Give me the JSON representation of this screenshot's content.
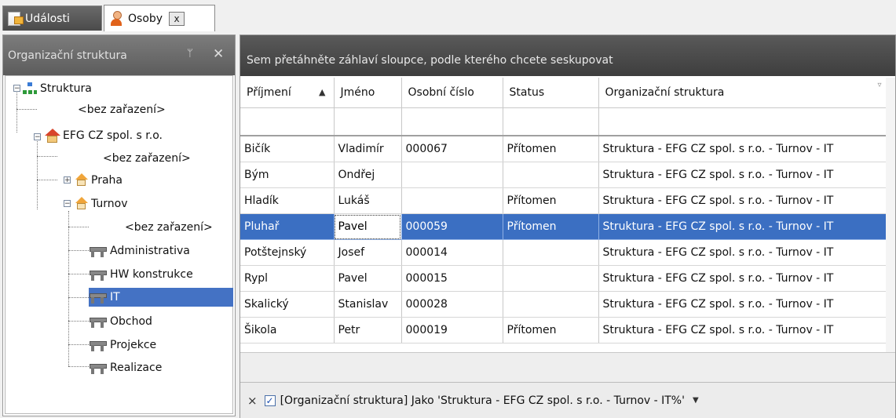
{
  "tabs": [
    {
      "label": "Události",
      "icon": "document-icon"
    },
    {
      "label": "Osoby",
      "icon": "person-icon",
      "close": "x"
    }
  ],
  "left_panel": {
    "title": "Organizační struktura",
    "pin": "ⵔ",
    "close": "✕",
    "tree": {
      "root": "Struktura",
      "root_unassigned": "<bez zařazení>",
      "company": "EFG CZ spol. s r.o.",
      "company_unassigned": "<bez zařazení>",
      "praha": "Praha",
      "turnov": "Turnov",
      "turnov_unassigned": "<bez zařazení>",
      "depts": [
        "Administrativa",
        "HW konstrukce",
        "IT",
        "Obchod",
        "Projekce",
        "Realizace"
      ],
      "selected": "IT"
    }
  },
  "grid": {
    "group_hint": "Sem přetáhněte záhlaví sloupce, podle kterého chcete seskupovat",
    "columns": [
      "Příjmení",
      "Jméno",
      "Osobní číslo",
      "Status",
      "Organizační struktura"
    ],
    "rows": [
      [
        "Bičík",
        "Vladimír",
        "000067",
        "Přítomen",
        "Struktura - EFG CZ spol. s r.o. - Turnov - IT"
      ],
      [
        "Bým",
        "Ondřej",
        "",
        "",
        "Struktura - EFG CZ spol. s r.o. - Turnov - IT"
      ],
      [
        "Hladík",
        "Lukáš",
        "",
        "Přítomen",
        "Struktura - EFG CZ spol. s r.o. - Turnov - IT"
      ],
      [
        "Pluhař",
        "Pavel",
        "000059",
        "Přítomen",
        "Struktura - EFG CZ spol. s r.o. - Turnov - IT"
      ],
      [
        "Potštejnský",
        "Josef",
        "000014",
        "",
        "Struktura - EFG CZ spol. s r.o. - Turnov - IT"
      ],
      [
        "Rypl",
        "Pavel",
        "000015",
        "",
        "Struktura - EFG CZ spol. s r.o. - Turnov - IT"
      ],
      [
        "Skalický",
        "Stanislav",
        "000028",
        "",
        "Struktura - EFG CZ spol. s r.o. - Turnov - IT"
      ],
      [
        "Šikola",
        "Petr",
        "000019",
        "Přítomen",
        "Struktura - EFG CZ spol. s r.o. - Turnov - IT"
      ]
    ],
    "selected_row": 3,
    "filter": {
      "remove": "×",
      "checked": "✓",
      "text": "[Organizační struktura] Jako 'Struktura - EFG CZ spol. s r.o. - Turnov - IT%'",
      "dropdown": "▼"
    }
  }
}
